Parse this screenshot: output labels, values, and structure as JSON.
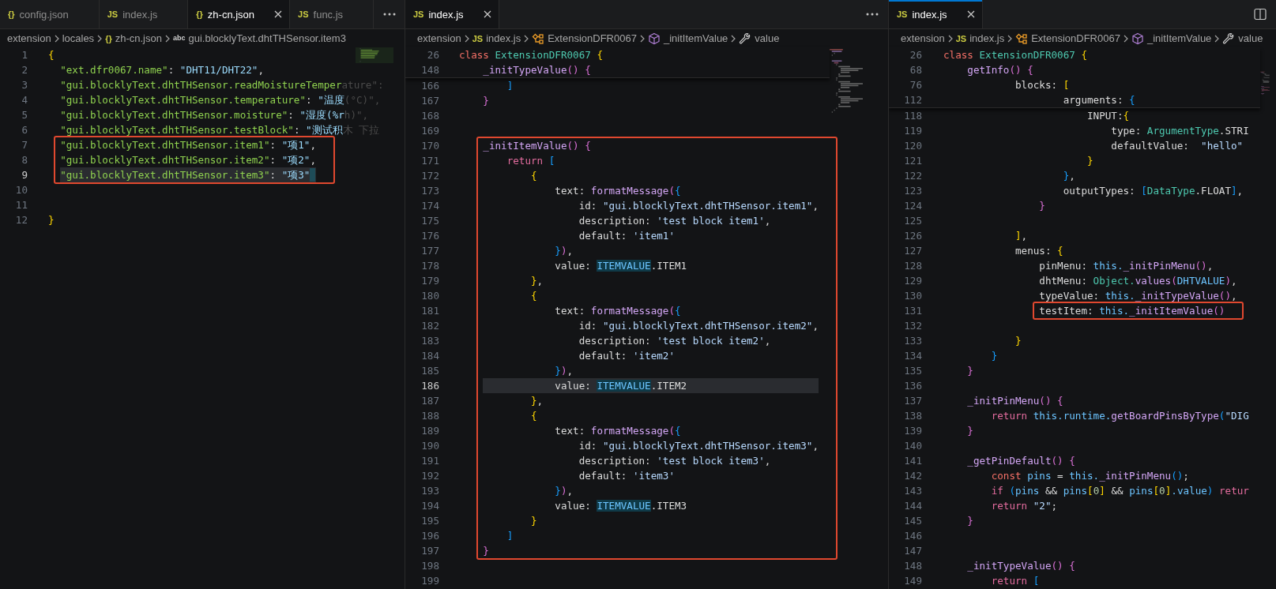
{
  "panes": [
    {
      "focused": false,
      "tabs": [
        {
          "badge": "{}",
          "label": "config.json",
          "selected": false
        },
        {
          "badge": "JS",
          "label": "index.js",
          "selected": false
        },
        {
          "badge": "{}",
          "label": "zh-cn.json",
          "selected": true
        },
        {
          "badge": "JS",
          "label": "func.js",
          "selected": false
        }
      ],
      "actions": [
        {
          "kind": "more"
        }
      ],
      "breadcrumbs": [
        {
          "label": "extension"
        },
        {
          "label": "locales"
        },
        {
          "kind": "file",
          "badge": "{}",
          "label": "zh-cn.json"
        },
        {
          "kind": "string",
          "badge": "abc",
          "label": "gui.blocklyText.dhtTHSensor.item3"
        }
      ],
      "blocks": [
        {
          "boxed": false,
          "lines": [
            {
              "n": "1",
              "current": false,
              "cursor": false,
              "tokens": [
                {
                  "kind": "b1",
                  "text": "{"
                }
              ]
            },
            {
              "n": "2",
              "current": false,
              "cursor": false,
              "tokens": [
                {
                  "kind": "key",
                  "text": "  \"ext.dfr0067.name\""
                },
                {
                  "kind": "plain",
                  "text": ": "
                },
                {
                  "kind": "val",
                  "text": "\"DHT11/DHT22\""
                },
                {
                  "kind": "plain",
                  "text": ","
                }
              ]
            },
            {
              "n": "3",
              "current": false,
              "cursor": false,
              "tokens": [
                {
                  "kind": "key",
                  "text": "  \"gui.blocklyText.dhtTHSensor.readMoistureTemper"
                },
                {
                  "kind": "dim",
                  "text": "ature\":"
                }
              ]
            },
            {
              "n": "4",
              "current": false,
              "cursor": false,
              "tokens": [
                {
                  "kind": "key",
                  "text": "  \"gui.blocklyText.dhtTHSensor.temperature\""
                },
                {
                  "kind": "plain",
                  "text": ": "
                },
                {
                  "kind": "val",
                  "text": "\"温度"
                },
                {
                  "kind": "dim",
                  "text": "(°C)\","
                }
              ]
            },
            {
              "n": "5",
              "current": false,
              "cursor": false,
              "tokens": [
                {
                  "kind": "key",
                  "text": "  \"gui.blocklyText.dhtTHSensor.moisture\""
                },
                {
                  "kind": "plain",
                  "text": ": "
                },
                {
                  "kind": "val",
                  "text": "\"湿度(%r"
                },
                {
                  "kind": "dim",
                  "text": "h)\","
                }
              ]
            },
            {
              "n": "6",
              "current": false,
              "cursor": false,
              "tokens": [
                {
                  "kind": "key",
                  "text": "  \"gui.blocklyText.dhtTHSensor.testBlock\""
                },
                {
                  "kind": "plain",
                  "text": ": "
                },
                {
                  "kind": "val",
                  "text": "\"测试积"
                },
                {
                  "kind": "dim",
                  "text": "木 下拉"
                }
              ]
            }
          ]
        },
        {
          "boxed": true,
          "lines": [
            {
              "n": "7",
              "current": false,
              "cursor": false,
              "tokens": [
                {
                  "kind": "key",
                  "text": "  \"gui.blocklyText.dhtTHSensor.item1\""
                },
                {
                  "kind": "plain",
                  "text": ": "
                },
                {
                  "kind": "val",
                  "text": "\"项1\""
                },
                {
                  "kind": "plain",
                  "text": ","
                }
              ]
            },
            {
              "n": "8",
              "current": false,
              "cursor": false,
              "tokens": [
                {
                  "kind": "key",
                  "text": "  \"gui.blocklyText.dhtTHSensor.item2\""
                },
                {
                  "kind": "plain",
                  "text": ": "
                },
                {
                  "kind": "val",
                  "text": "\"项2\""
                },
                {
                  "kind": "plain",
                  "text": ","
                }
              ]
            },
            {
              "n": "9",
              "current": true,
              "cursor": true,
              "tokens": [
                {
                  "kind": "key",
                  "text": "  \"gui.blocklyText.dhtTHSensor.item3\""
                },
                {
                  "kind": "plain",
                  "text": ": "
                },
                {
                  "kind": "val",
                  "text": "\"项3\""
                }
              ]
            }
          ]
        },
        {
          "boxed": false,
          "lines": [
            {
              "n": "10",
              "current": false,
              "cursor": false
            },
            {
              "n": "11",
              "current": false,
              "cursor": false
            },
            {
              "n": "12",
              "current": false,
              "cursor": false,
              "tokens": [
                {
                  "kind": "b1",
                  "text": "}"
                }
              ]
            }
          ]
        }
      ]
    },
    {
      "focused": false,
      "tabs": [
        {
          "badge": "JS",
          "label": "index.js",
          "selected": true
        }
      ],
      "actions": [
        {
          "kind": "more"
        }
      ],
      "breadcrumbs": [
        {
          "label": "extension"
        },
        {
          "kind": "file",
          "badge": "JS",
          "label": "index.js"
        },
        {
          "kind": "class",
          "label": "ExtensionDFR0067"
        },
        {
          "kind": "method",
          "label": "_initItemValue"
        },
        {
          "kind": "field",
          "label": "value"
        }
      ],
      "sticky": [
        {
          "n": "26",
          "tokens": [
            {
              "kind": "storage",
              "text": "class"
            },
            {
              "kind": "type",
              "text": " ExtensionDFR0067"
            },
            {
              "kind": "b1",
              "text": " {"
            }
          ]
        },
        {
          "n": "148",
          "tokens": [
            {
              "kind": "func",
              "text": "    _initTypeValue"
            },
            {
              "kind": "b2",
              "text": "()"
            },
            {
              "kind": "b2",
              "text": " {"
            }
          ]
        }
      ],
      "blocks": [
        {
          "boxed": false,
          "lines": [
            {
              "n": "166",
              "current": false,
              "tokens": [
                {
                  "kind": "b3",
                  "text": "        ]"
                }
              ]
            },
            {
              "n": "167",
              "current": false,
              "tokens": [
                {
                  "kind": "b2",
                  "text": "    }"
                }
              ]
            },
            {
              "n": "168",
              "current": false
            },
            {
              "n": "169",
              "current": false
            }
          ]
        },
        {
          "boxed": true,
          "lines": [
            {
              "n": "170",
              "current": false,
              "tokens": [
                {
                  "kind": "func",
                  "text": "    _initItemValue"
                },
                {
                  "kind": "b2",
                  "text": "()"
                },
                {
                  "kind": "b2",
                  "text": " {"
                }
              ]
            },
            {
              "n": "171",
              "current": false,
              "tokens": [
                {
                  "kind": "control",
                  "text": "        return"
                },
                {
                  "kind": "b3",
                  "text": " ["
                }
              ]
            },
            {
              "n": "172",
              "current": false,
              "tokens": [
                {
                  "kind": "b1",
                  "text": "            {"
                }
              ]
            },
            {
              "n": "173",
              "current": false,
              "tokens": [
                {
                  "kind": "plain",
                  "text": "                text: "
                },
                {
                  "kind": "func",
                  "text": "formatMessage"
                },
                {
                  "kind": "b2",
                  "text": "("
                },
                {
                  "kind": "b3",
                  "text": "{"
                }
              ]
            },
            {
              "n": "174",
              "current": false,
              "tokens": [
                {
                  "kind": "plain",
                  "text": "                    id: "
                },
                {
                  "kind": "str",
                  "text": "\"gui.blocklyText.dhtTHSensor.item1\""
                },
                {
                  "kind": "plain",
                  "text": ","
                }
              ]
            },
            {
              "n": "175",
              "current": false,
              "tokens": [
                {
                  "kind": "plain",
                  "text": "                    description: "
                },
                {
                  "kind": "str",
                  "text": "'test block item1'"
                },
                {
                  "kind": "plain",
                  "text": ","
                }
              ]
            },
            {
              "n": "176",
              "current": false,
              "tokens": [
                {
                  "kind": "plain",
                  "text": "                    default: "
                },
                {
                  "kind": "str",
                  "text": "'item1'"
                }
              ]
            },
            {
              "n": "177",
              "current": false,
              "tokens": [
                {
                  "kind": "b3",
                  "text": "                }"
                },
                {
                  "kind": "b2",
                  "text": ")"
                },
                {
                  "kind": "plain",
                  "text": ","
                }
              ]
            },
            {
              "n": "178",
              "current": false,
              "tokens": [
                {
                  "kind": "plain",
                  "text": "                value: "
                },
                {
                  "kind": "hl",
                  "text": "ITEMVALUE"
                },
                {
                  "kind": "plain",
                  "text": ".ITEM1"
                }
              ]
            },
            {
              "n": "179",
              "current": false,
              "tokens": [
                {
                  "kind": "b1",
                  "text": "            }"
                },
                {
                  "kind": "plain",
                  "text": ","
                }
              ]
            },
            {
              "n": "180",
              "current": false,
              "tokens": [
                {
                  "kind": "b1",
                  "text": "            {"
                }
              ]
            },
            {
              "n": "181",
              "current": false,
              "tokens": [
                {
                  "kind": "plain",
                  "text": "                text: "
                },
                {
                  "kind": "func",
                  "text": "formatMessage"
                },
                {
                  "kind": "b2",
                  "text": "("
                },
                {
                  "kind": "b3",
                  "text": "{"
                }
              ]
            },
            {
              "n": "182",
              "current": false,
              "tokens": [
                {
                  "kind": "plain",
                  "text": "                    id: "
                },
                {
                  "kind": "str",
                  "text": "\"gui.blocklyText.dhtTHSensor.item2\""
                },
                {
                  "kind": "plain",
                  "text": ","
                }
              ]
            },
            {
              "n": "183",
              "current": false,
              "tokens": [
                {
                  "kind": "plain",
                  "text": "                    description: "
                },
                {
                  "kind": "str",
                  "text": "'test block item2'"
                },
                {
                  "kind": "plain",
                  "text": ","
                }
              ]
            },
            {
              "n": "184",
              "current": false,
              "tokens": [
                {
                  "kind": "plain",
                  "text": "                    default: "
                },
                {
                  "kind": "str",
                  "text": "'item2'"
                }
              ]
            },
            {
              "n": "185",
              "current": false,
              "tokens": [
                {
                  "kind": "b3",
                  "text": "                }"
                },
                {
                  "kind": "b2",
                  "text": ")"
                },
                {
                  "kind": "plain",
                  "text": ","
                }
              ]
            },
            {
              "n": "186",
              "current": true,
              "tokens": [
                {
                  "kind": "plain",
                  "text": "                value: "
                },
                {
                  "kind": "hl",
                  "text": "ITEMVALUE"
                },
                {
                  "kind": "plain",
                  "text": ".ITEM2"
                }
              ]
            },
            {
              "n": "187",
              "current": false,
              "tokens": [
                {
                  "kind": "b1",
                  "text": "            }"
                },
                {
                  "kind": "plain",
                  "text": ","
                }
              ]
            },
            {
              "n": "188",
              "current": false,
              "tokens": [
                {
                  "kind": "b1",
                  "text": "            {"
                }
              ]
            },
            {
              "n": "189",
              "current": false,
              "tokens": [
                {
                  "kind": "plain",
                  "text": "                text: "
                },
                {
                  "kind": "func",
                  "text": "formatMessage"
                },
                {
                  "kind": "b2",
                  "text": "("
                },
                {
                  "kind": "b3",
                  "text": "{"
                }
              ]
            },
            {
              "n": "190",
              "current": false,
              "tokens": [
                {
                  "kind": "plain",
                  "text": "                    id: "
                },
                {
                  "kind": "str",
                  "text": "\"gui.blocklyText.dhtTHSensor.item3\""
                },
                {
                  "kind": "plain",
                  "text": ","
                }
              ]
            },
            {
              "n": "191",
              "current": false,
              "tokens": [
                {
                  "kind": "plain",
                  "text": "                    description: "
                },
                {
                  "kind": "str",
                  "text": "'test block item3'"
                },
                {
                  "kind": "plain",
                  "text": ","
                }
              ]
            },
            {
              "n": "192",
              "current": false,
              "tokens": [
                {
                  "kind": "plain",
                  "text": "                    default: "
                },
                {
                  "kind": "str",
                  "text": "'item3'"
                }
              ]
            },
            {
              "n": "193",
              "current": false,
              "tokens": [
                {
                  "kind": "b3",
                  "text": "                }"
                },
                {
                  "kind": "b2",
                  "text": ")"
                },
                {
                  "kind": "plain",
                  "text": ","
                }
              ]
            },
            {
              "n": "194",
              "current": false,
              "tokens": [
                {
                  "kind": "plain",
                  "text": "                value: "
                },
                {
                  "kind": "hl",
                  "text": "ITEMVALUE"
                },
                {
                  "kind": "plain",
                  "text": ".ITEM3"
                }
              ]
            },
            {
              "n": "195",
              "current": false,
              "tokens": [
                {
                  "kind": "b1",
                  "text": "            }"
                }
              ]
            },
            {
              "n": "196",
              "current": false,
              "tokens": [
                {
                  "kind": "b3",
                  "text": "        ]"
                }
              ]
            },
            {
              "n": "197",
              "current": false,
              "tokens": [
                {
                  "kind": "b2",
                  "text": "    }"
                }
              ]
            }
          ]
        },
        {
          "boxed": false,
          "lines": [
            {
              "n": "198",
              "current": false
            },
            {
              "n": "199",
              "current": false
            }
          ]
        }
      ]
    },
    {
      "focused": true,
      "tabs": [
        {
          "badge": "JS",
          "label": "index.js",
          "selected": true
        }
      ],
      "actions": [
        {
          "kind": "split"
        }
      ],
      "breadcrumbs": [
        {
          "label": "extension"
        },
        {
          "kind": "file",
          "badge": "JS",
          "label": "index.js"
        },
        {
          "kind": "class",
          "label": "ExtensionDFR0067"
        },
        {
          "kind": "method",
          "label": "_initItemValue"
        },
        {
          "kind": "field",
          "label": "value"
        }
      ],
      "sticky": [
        {
          "n": "26",
          "tokens": [
            {
              "kind": "storage",
              "text": "class"
            },
            {
              "kind": "type",
              "text": " ExtensionDFR0067"
            },
            {
              "kind": "b1",
              "text": " {"
            }
          ]
        },
        {
          "n": "68",
          "tokens": [
            {
              "kind": "func",
              "text": "    getInfo"
            },
            {
              "kind": "b2",
              "text": "()"
            },
            {
              "kind": "b2",
              "text": " {"
            }
          ]
        },
        {
          "n": "76",
          "tokens": [
            {
              "kind": "plain",
              "text": "            blocks: "
            },
            {
              "kind": "b1",
              "text": "["
            }
          ]
        },
        {
          "n": "112",
          "tokens": [
            {
              "kind": "plain",
              "text": "                    arguments: "
            },
            {
              "kind": "b3",
              "text": "{"
            }
          ]
        }
      ],
      "blocks": [
        {
          "boxed": false,
          "lines": [
            {
              "n": "118",
              "tokens": [
                {
                  "kind": "plain",
                  "text": "                        INPUT:"
                },
                {
                  "kind": "b1",
                  "text": "{"
                }
              ]
            },
            {
              "n": "119",
              "tokens": [
                {
                  "kind": "plain",
                  "text": "                            type: "
                },
                {
                  "kind": "type",
                  "text": "ArgumentType"
                },
                {
                  "kind": "plain",
                  "text": ".STRI"
                }
              ]
            },
            {
              "n": "120",
              "tokens": [
                {
                  "kind": "plain",
                  "text": "                            defaultValue:  "
                },
                {
                  "kind": "str",
                  "text": "\"hello\""
                }
              ]
            },
            {
              "n": "121",
              "tokens": [
                {
                  "kind": "b1",
                  "text": "                        }"
                }
              ]
            },
            {
              "n": "122",
              "tokens": [
                {
                  "kind": "b3",
                  "text": "                    }"
                },
                {
                  "kind": "plain",
                  "text": ","
                }
              ]
            },
            {
              "n": "123",
              "tokens": [
                {
                  "kind": "plain",
                  "text": "                    outputTypes: "
                },
                {
                  "kind": "b3",
                  "text": "["
                },
                {
                  "kind": "type",
                  "text": "DataType"
                },
                {
                  "kind": "plain",
                  "text": ".FLOAT"
                },
                {
                  "kind": "b3",
                  "text": "]"
                },
                {
                  "kind": "plain",
                  "text": ","
                }
              ]
            },
            {
              "n": "124",
              "tokens": [
                {
                  "kind": "b2",
                  "text": "                }"
                }
              ]
            },
            {
              "n": "125"
            },
            {
              "n": "126",
              "tokens": [
                {
                  "kind": "b1",
                  "text": "            ]"
                },
                {
                  "kind": "plain",
                  "text": ","
                }
              ]
            },
            {
              "n": "127",
              "tokens": [
                {
                  "kind": "plain",
                  "text": "            menus: "
                },
                {
                  "kind": "b1",
                  "text": "{"
                }
              ]
            },
            {
              "n": "128",
              "tokens": [
                {
                  "kind": "plain",
                  "text": "                pinMenu: "
                },
                {
                  "kind": "var",
                  "text": "this."
                },
                {
                  "kind": "func",
                  "text": "_initPinMenu"
                },
                {
                  "kind": "b2",
                  "text": "()"
                },
                {
                  "kind": "plain",
                  "text": ","
                }
              ]
            },
            {
              "n": "129",
              "tokens": [
                {
                  "kind": "plain",
                  "text": "                dhtMenu: "
                },
                {
                  "kind": "type",
                  "text": "Object."
                },
                {
                  "kind": "func",
                  "text": "values"
                },
                {
                  "kind": "b2",
                  "text": "("
                },
                {
                  "kind": "var",
                  "text": "DHTVALUE"
                },
                {
                  "kind": "b2",
                  "text": ")"
                },
                {
                  "kind": "plain",
                  "text": ","
                }
              ]
            },
            {
              "n": "130",
              "tokens": [
                {
                  "kind": "plain",
                  "text": "                typeValue: "
                },
                {
                  "kind": "var",
                  "text": "this."
                },
                {
                  "kind": "func",
                  "text": "_initTypeValue"
                },
                {
                  "kind": "b2",
                  "text": "()"
                },
                {
                  "kind": "plain",
                  "text": ","
                }
              ]
            }
          ]
        },
        {
          "boxed": true,
          "lines": [
            {
              "n": "131",
              "tokens": [
                {
                  "kind": "plain",
                  "text": "                testItem: "
                },
                {
                  "kind": "var",
                  "text": "this."
                },
                {
                  "kind": "func",
                  "text": "_initItemValue"
                },
                {
                  "kind": "b2",
                  "text": "()"
                }
              ]
            }
          ]
        },
        {
          "boxed": false,
          "lines": [
            {
              "n": "132"
            },
            {
              "n": "133",
              "tokens": [
                {
                  "kind": "b1",
                  "text": "            }"
                }
              ]
            },
            {
              "n": "134",
              "tokens": [
                {
                  "kind": "b3",
                  "text": "        }"
                }
              ]
            },
            {
              "n": "135",
              "tokens": [
                {
                  "kind": "b2",
                  "text": "    }"
                }
              ]
            },
            {
              "n": "136"
            },
            {
              "n": "137",
              "tokens": [
                {
                  "kind": "func",
                  "text": "    _initPinMenu"
                },
                {
                  "kind": "b2",
                  "text": "()"
                },
                {
                  "kind": "b2",
                  "text": " {"
                }
              ]
            },
            {
              "n": "138",
              "tokens": [
                {
                  "kind": "control",
                  "text": "        return"
                },
                {
                  "kind": "var",
                  "text": " this.runtime."
                },
                {
                  "kind": "func",
                  "text": "getBoardPinsByType"
                },
                {
                  "kind": "b3",
                  "text": "("
                },
                {
                  "kind": "str",
                  "text": "\"DIG"
                }
              ]
            },
            {
              "n": "139",
              "tokens": [
                {
                  "kind": "b2",
                  "text": "    }"
                }
              ]
            },
            {
              "n": "140"
            },
            {
              "n": "141",
              "tokens": [
                {
                  "kind": "func",
                  "text": "    _getPinDefault"
                },
                {
                  "kind": "b2",
                  "text": "()"
                },
                {
                  "kind": "b2",
                  "text": " {"
                }
              ]
            },
            {
              "n": "142",
              "tokens": [
                {
                  "kind": "storage",
                  "text": "        const"
                },
                {
                  "kind": "var",
                  "text": " pins"
                },
                {
                  "kind": "plain",
                  "text": " = "
                },
                {
                  "kind": "var",
                  "text": "this."
                },
                {
                  "kind": "func",
                  "text": "_initPinMenu"
                },
                {
                  "kind": "b3",
                  "text": "()"
                },
                {
                  "kind": "plain",
                  "text": ";"
                }
              ]
            },
            {
              "n": "143",
              "tokens": [
                {
                  "kind": "control",
                  "text": "        if"
                },
                {
                  "kind": "b3",
                  "text": " ("
                },
                {
                  "kind": "var",
                  "text": "pins"
                },
                {
                  "kind": "plain",
                  "text": " && "
                },
                {
                  "kind": "var",
                  "text": "pins"
                },
                {
                  "kind": "b1",
                  "text": "["
                },
                {
                  "kind": "num",
                  "text": "0"
                },
                {
                  "kind": "b1",
                  "text": "]"
                },
                {
                  "kind": "plain",
                  "text": " && "
                },
                {
                  "kind": "var",
                  "text": "pins"
                },
                {
                  "kind": "b1",
                  "text": "["
                },
                {
                  "kind": "num",
                  "text": "0"
                },
                {
                  "kind": "b1",
                  "text": "]"
                },
                {
                  "kind": "var",
                  "text": ".value"
                },
                {
                  "kind": "b3",
                  "text": ")"
                },
                {
                  "kind": "control",
                  "text": " retur"
                }
              ]
            },
            {
              "n": "144",
              "tokens": [
                {
                  "kind": "control",
                  "text": "        return"
                },
                {
                  "kind": "str",
                  "text": " \"2\""
                },
                {
                  "kind": "plain",
                  "text": ";"
                }
              ]
            },
            {
              "n": "145",
              "tokens": [
                {
                  "kind": "b2",
                  "text": "    }"
                }
              ]
            },
            {
              "n": "146"
            },
            {
              "n": "147"
            },
            {
              "n": "148",
              "tokens": [
                {
                  "kind": "func",
                  "text": "    _initTypeValue"
                },
                {
                  "kind": "b2",
                  "text": "()"
                },
                {
                  "kind": "b2",
                  "text": " {"
                }
              ]
            },
            {
              "n": "149",
              "tokens": [
                {
                  "kind": "control",
                  "text": "        return"
                },
                {
                  "kind": "b3",
                  "text": " ["
                }
              ]
            }
          ]
        }
      ]
    }
  ]
}
